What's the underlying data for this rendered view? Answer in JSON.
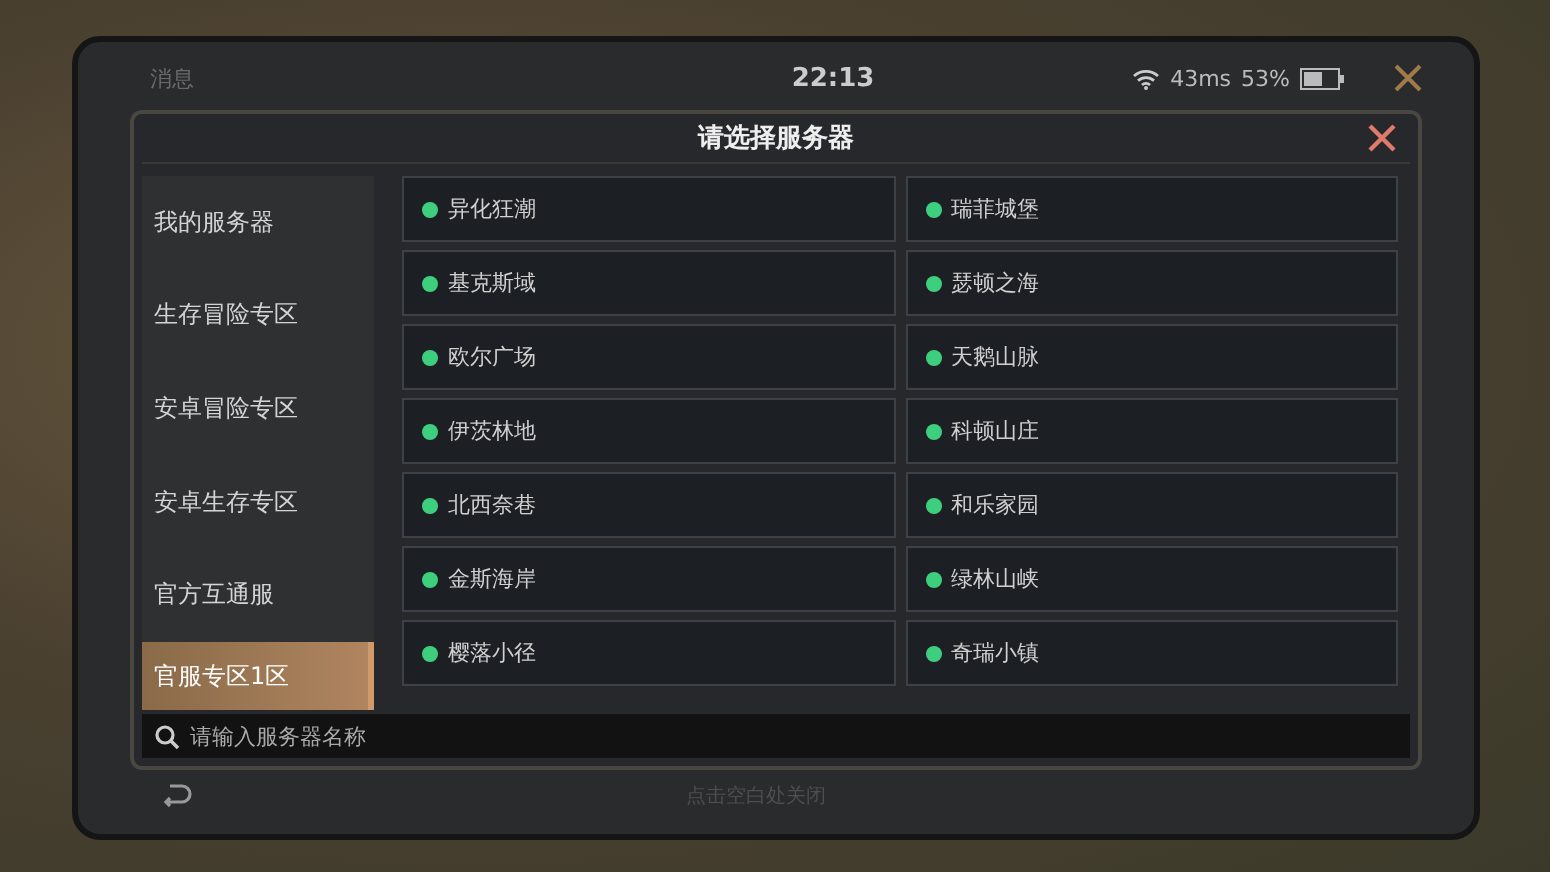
{
  "status_bar": {
    "messages": "消息",
    "time": "22:13",
    "ping": "43ms",
    "battery": "53%"
  },
  "dialog": {
    "title": "请选择服务器",
    "sidebar": {
      "items": [
        {
          "label": "我的服务器",
          "selected": false
        },
        {
          "label": "生存冒险专区",
          "selected": false
        },
        {
          "label": "安卓冒险专区",
          "selected": false
        },
        {
          "label": "安卓生存专区",
          "selected": false
        },
        {
          "label": "官方互通服",
          "selected": false
        },
        {
          "label": "官服专区1区",
          "selected": true
        }
      ]
    },
    "servers": [
      {
        "name": "异化狂潮",
        "color": "#3ecf7e"
      },
      {
        "name": "瑞菲城堡",
        "color": "#3ecf7e"
      },
      {
        "name": "基克斯域",
        "color": "#3ecf7e"
      },
      {
        "name": "瑟顿之海",
        "color": "#3ecf7e"
      },
      {
        "name": "欧尔广场",
        "color": "#3ecf7e"
      },
      {
        "name": "天鹅山脉",
        "color": "#3ecf7e"
      },
      {
        "name": "伊茨林地",
        "color": "#3ecf7e"
      },
      {
        "name": "科顿山庄",
        "color": "#3ecf7e"
      },
      {
        "name": "北西奈巷",
        "color": "#3ecf7e"
      },
      {
        "name": "和乐家园",
        "color": "#3ecf7e"
      },
      {
        "name": "金斯海岸",
        "color": "#3ecf7e"
      },
      {
        "name": "绿林山峡",
        "color": "#3ecf7e"
      },
      {
        "name": "樱落小径",
        "color": "#3ecf7e"
      },
      {
        "name": "奇瑞小镇",
        "color": "#3ecf7e"
      }
    ],
    "search": {
      "placeholder": "请输入服务器名称"
    }
  },
  "footer_hint": "点击空白处关闭"
}
